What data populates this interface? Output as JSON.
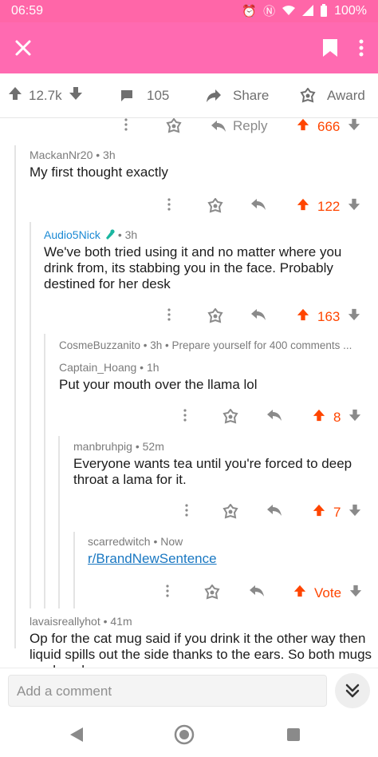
{
  "status_bar": {
    "time": "06:59",
    "battery": "100%"
  },
  "post_bar": {
    "upvotes": "12.7k",
    "comments": "105",
    "share": "Share",
    "award": "Award"
  },
  "top_actions": {
    "reply": "Reply",
    "votes": "666"
  },
  "comments": [
    {
      "meta": "MackanNr20 • 3h",
      "body": "My first thought exactly",
      "votes": "122"
    },
    {
      "author": "Audio5Nick",
      "time": " • 3h",
      "body": "We've both tried using it and no matter where you drink from, its stabbing you in the face. Probably destined for her desk",
      "votes": "163"
    },
    {
      "collapsed": "CosmeBuzzanito • 3h • Prepare yourself for 400 comments ...",
      "meta": "Captain_Hoang • 1h",
      "body": "Put your mouth over the llama lol",
      "votes": "8"
    },
    {
      "meta": "manbruhpig • 52m",
      "body": "Everyone wants tea until you're forced to deep throat a lama for it.",
      "votes": "7"
    },
    {
      "meta": "scarredwitch • Now",
      "link": "r/BrandNewSentence",
      "votes": "Vote"
    },
    {
      "meta": "lavaisreallyhot • 41m",
      "body": "Op for the cat mug said if you drink it the other way then liquid spills out the side thanks to the ears. So both mugs are lose lose"
    }
  ],
  "composer": {
    "placeholder": "Add a comment"
  },
  "colors": {
    "brand": "#ff6ab1",
    "upvote": "#ff4500",
    "user_flair": "#1a89d4"
  }
}
